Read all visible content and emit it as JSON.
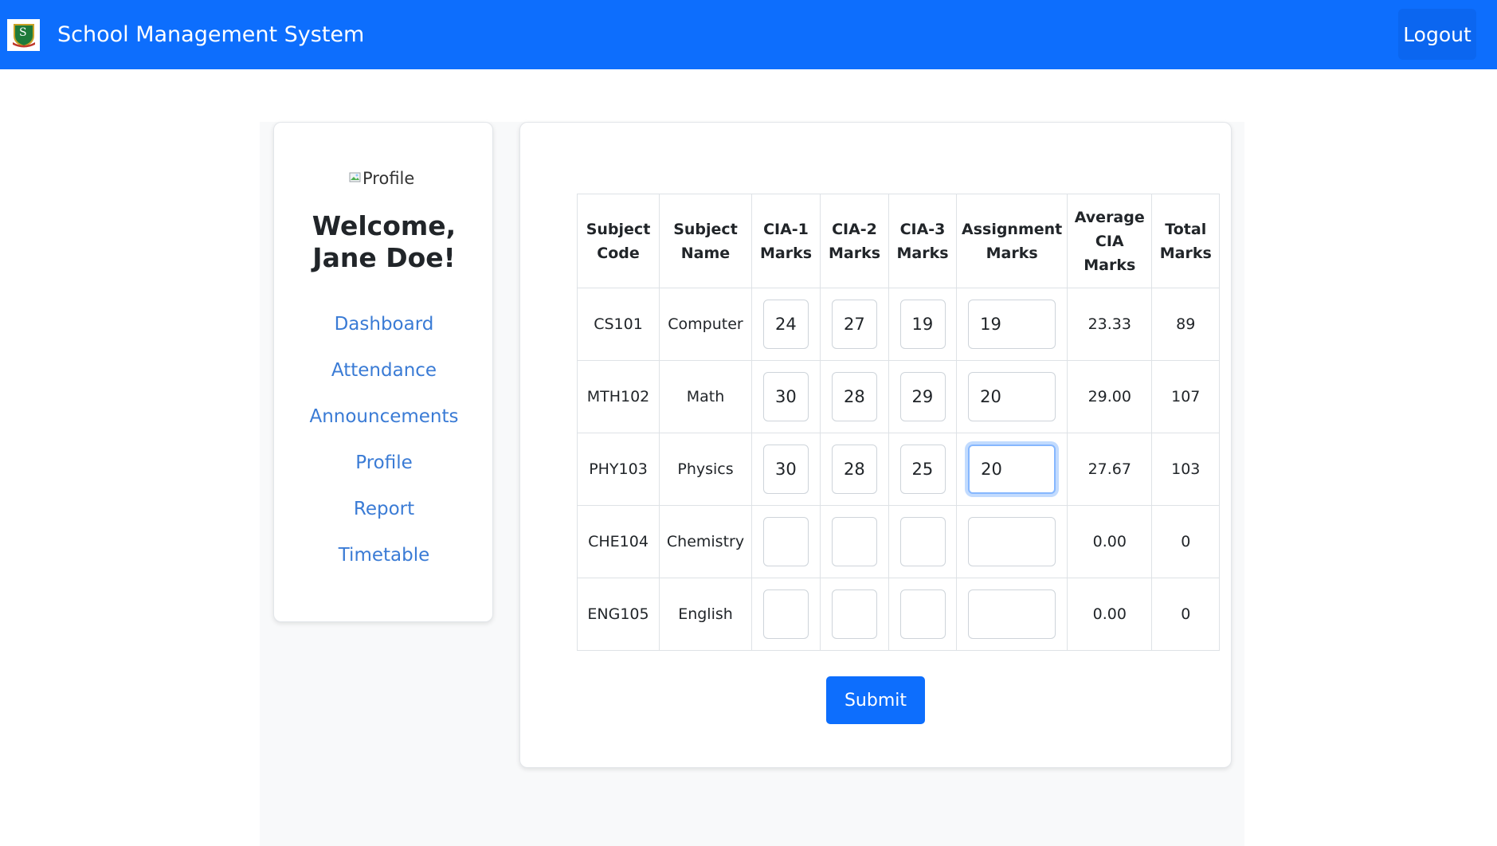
{
  "navbar": {
    "title": "School Management System",
    "logo_letter": "S",
    "logout_label": "Logout"
  },
  "sidebar": {
    "profile_alt": "Profile",
    "welcome_line1": "Welcome,",
    "welcome_line2": "Jane Doe!",
    "links": [
      {
        "label": "Dashboard"
      },
      {
        "label": "Attendance"
      },
      {
        "label": "Announcements"
      },
      {
        "label": "Profile"
      },
      {
        "label": "Report"
      },
      {
        "label": "Timetable"
      }
    ]
  },
  "table": {
    "headers": {
      "code_1": "Subject",
      "code_2": "Code",
      "name_1": "Subject",
      "name_2": "Name",
      "cia1_1": "CIA-1",
      "cia1_2": "Marks",
      "cia2_1": "CIA-2",
      "cia2_2": "Marks",
      "cia3_1": "CIA-3",
      "cia3_2": "Marks",
      "asg_1": "Assignment",
      "asg_2": "Marks",
      "avg_1": "Average",
      "avg_2": "CIA",
      "avg_3": "Marks",
      "total_1": "Total",
      "total_2": "Marks"
    },
    "rows": [
      {
        "code": "CS101",
        "name": "Computer",
        "cia1": "24",
        "cia2": "27",
        "cia3": "19",
        "assignment": "19",
        "average": "23.33",
        "total": "89"
      },
      {
        "code": "MTH102",
        "name": "Math",
        "cia1": "30",
        "cia2": "28",
        "cia3": "29",
        "assignment": "20",
        "average": "29.00",
        "total": "107"
      },
      {
        "code": "PHY103",
        "name": "Physics",
        "cia1": "30",
        "cia2": "28",
        "cia3": "25",
        "assignment": "20",
        "average": "27.67",
        "total": "103"
      },
      {
        "code": "CHE104",
        "name": "Chemistry",
        "cia1": "",
        "cia2": "",
        "cia3": "",
        "assignment": "",
        "average": "0.00",
        "total": "0"
      },
      {
        "code": "ENG105",
        "name": "English",
        "cia1": "",
        "cia2": "",
        "cia3": "",
        "assignment": "",
        "average": "0.00",
        "total": "0"
      }
    ]
  },
  "submit_label": "Submit",
  "colors": {
    "primary": "#0d6efd",
    "link": "#3a7bd5",
    "focus_ring": "#86b7fe"
  }
}
